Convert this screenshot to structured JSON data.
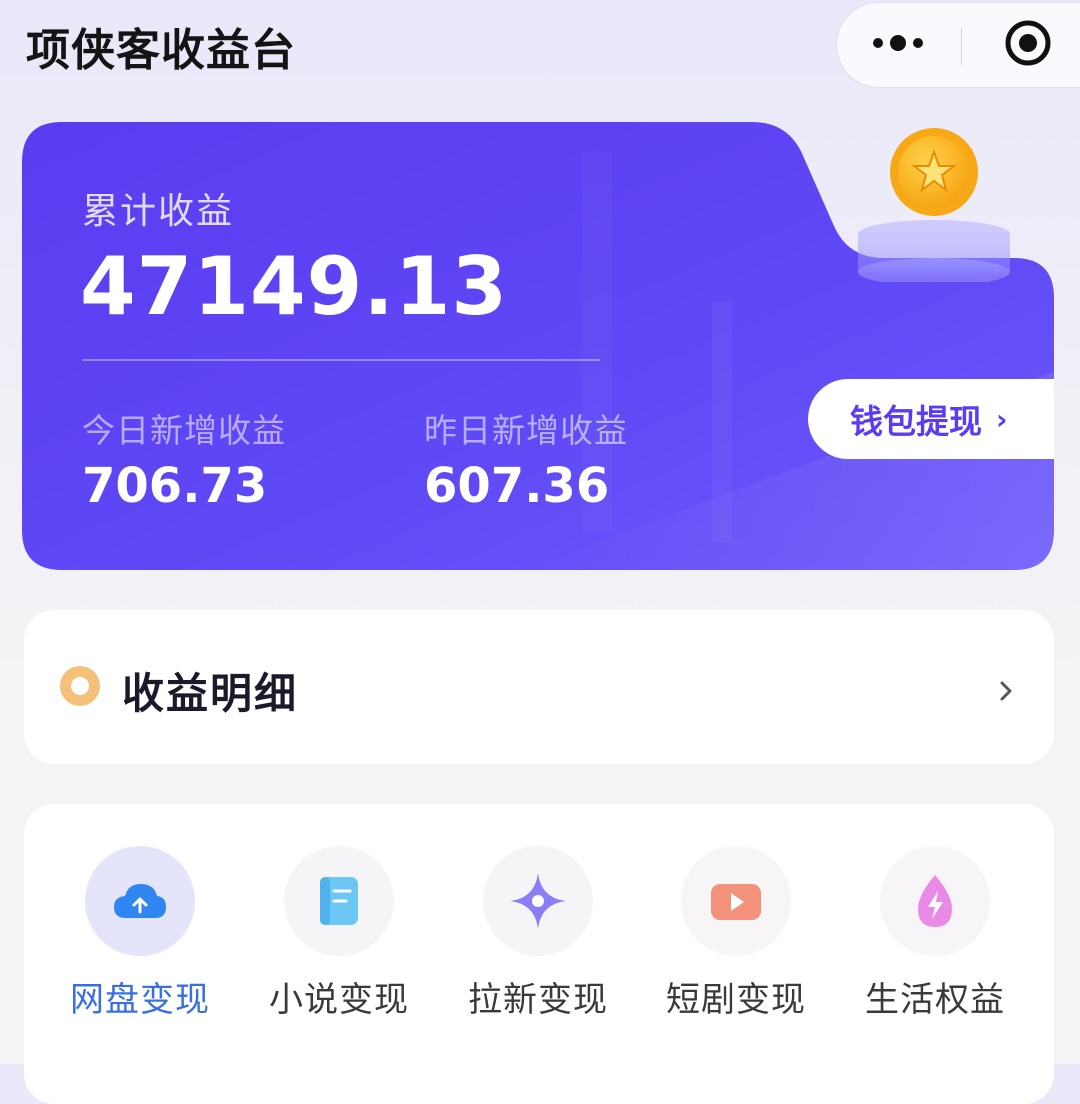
{
  "header": {
    "title": "项侠客收益台"
  },
  "earnings": {
    "total_label": "累计收益",
    "total_value": "47149.13",
    "today_label": "今日新增收益",
    "today_value": "706.73",
    "yesterday_label": "昨日新增收益",
    "yesterday_value": "607.36",
    "withdraw_label": "钱包提现"
  },
  "detail": {
    "title": "收益明细"
  },
  "categories": [
    {
      "label": "网盘变现",
      "icon": "cloud-upload-icon",
      "active": true
    },
    {
      "label": "小说变现",
      "icon": "book-icon",
      "active": false
    },
    {
      "label": "拉新变现",
      "icon": "sparkle-icon",
      "active": false
    },
    {
      "label": "短剧变现",
      "icon": "video-play-icon",
      "active": false
    },
    {
      "label": "生活权益",
      "icon": "drop-bolt-icon",
      "active": false
    }
  ],
  "colors": {
    "card_primary": "#5b3df2",
    "card_secondary": "#7a63ff",
    "active_label": "#3b6fe0",
    "coin": "#f7b21a"
  }
}
